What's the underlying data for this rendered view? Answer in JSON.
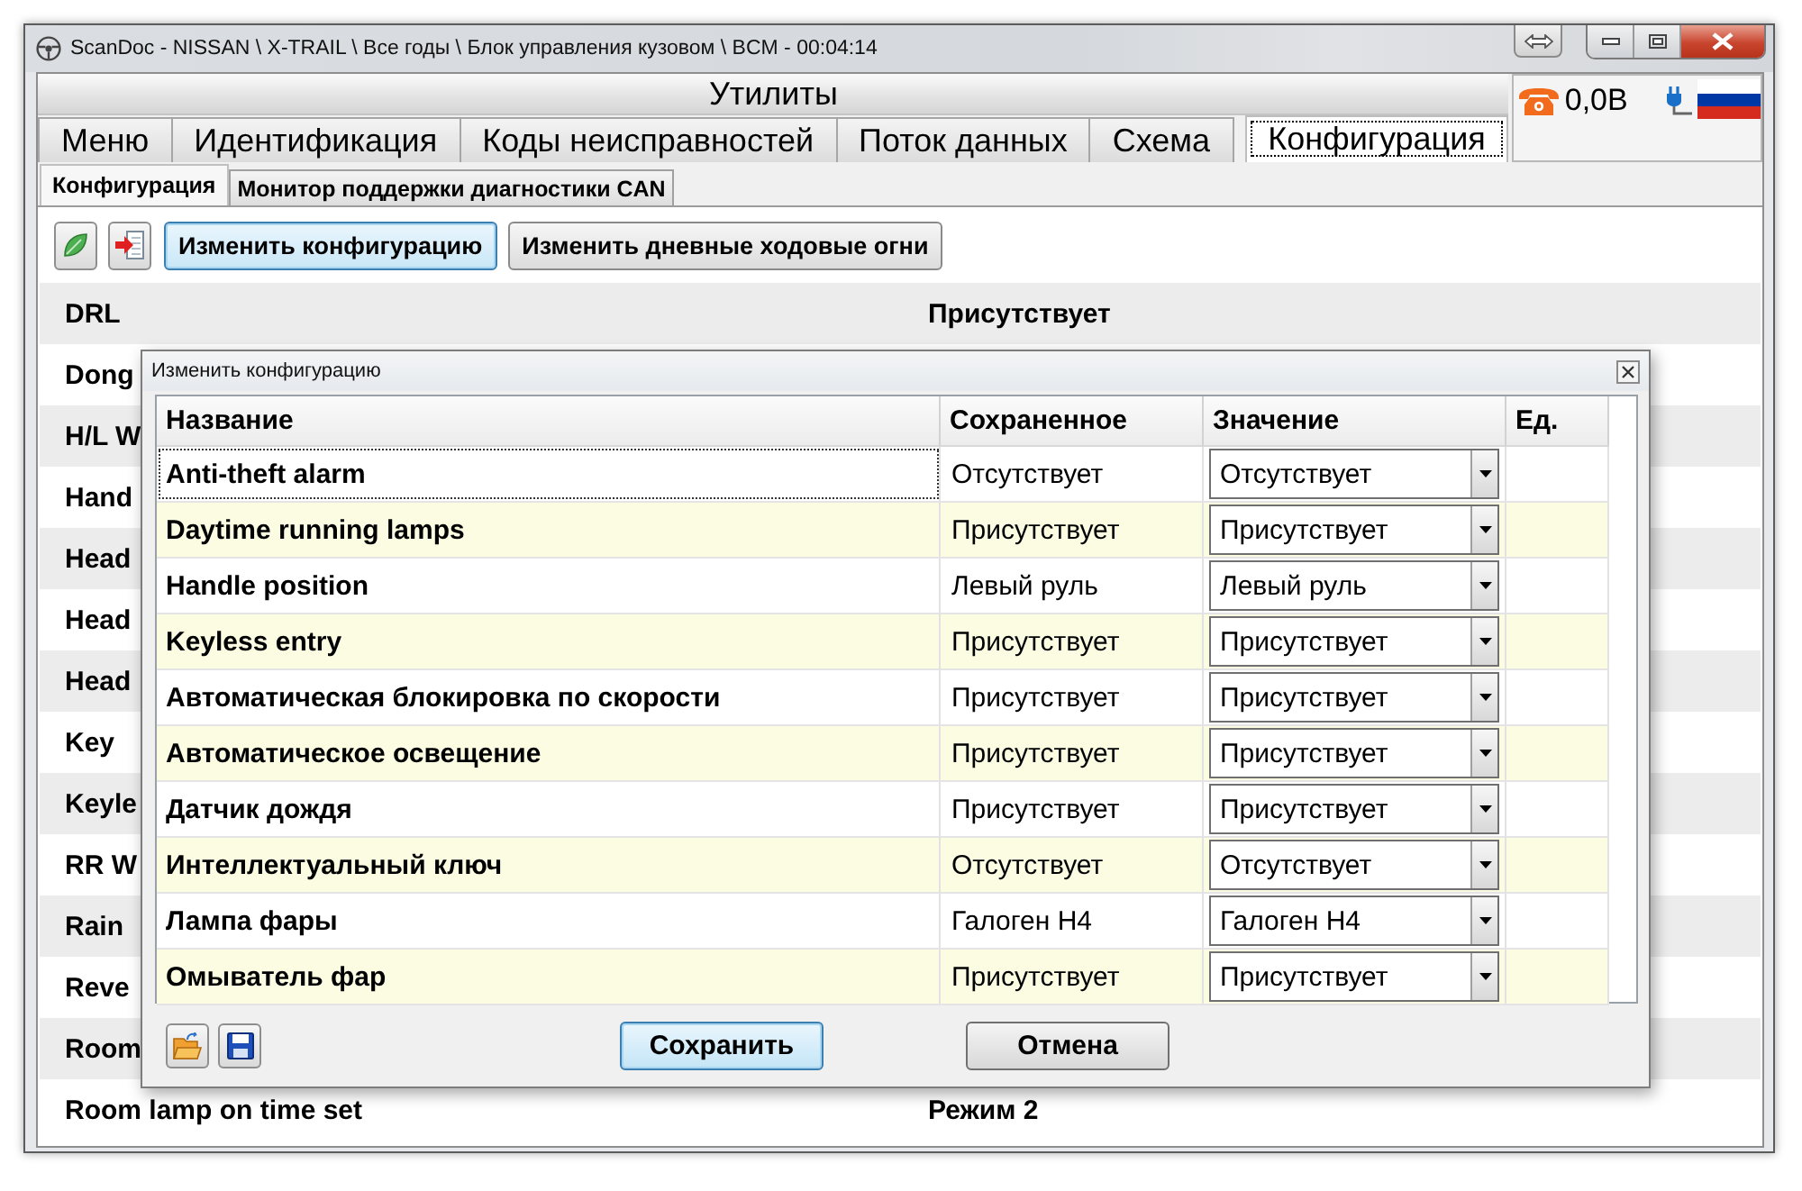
{
  "window": {
    "title": "ScanDoc - NISSAN \\ X-TRAIL \\ Все годы \\ Блок управления кузовом \\ BCM - 00:04:14"
  },
  "header": {
    "title": "Утилиты"
  },
  "status": {
    "voltage": "0,0В"
  },
  "tabs": [
    {
      "label": "Меню",
      "selected": false
    },
    {
      "label": "Идентификация",
      "selected": false
    },
    {
      "label": "Коды неисправностей",
      "selected": false
    },
    {
      "label": "Поток данных",
      "selected": false
    },
    {
      "label": "Схема",
      "selected": false
    },
    {
      "label": "Конфигурация",
      "selected": true
    }
  ],
  "subtabs": [
    {
      "label": "Конфигурация",
      "selected": true
    },
    {
      "label": "Монитор поддержки диагностики CAN",
      "selected": false
    }
  ],
  "toolbar": {
    "buttons": [
      {
        "label": "Изменить конфигурацию",
        "focused": true
      },
      {
        "label": "Изменить дневные ходовые огни",
        "focused": false
      }
    ]
  },
  "parameters": [
    {
      "name": "DRL",
      "value": "Присутствует"
    },
    {
      "name": "Dong"
    },
    {
      "name": "H/L W"
    },
    {
      "name": "Hand"
    },
    {
      "name": "Head"
    },
    {
      "name": "Head"
    },
    {
      "name": "Head"
    },
    {
      "name": "Key"
    },
    {
      "name": "Keyle"
    },
    {
      "name": "RR W"
    },
    {
      "name": "Rain"
    },
    {
      "name": "Reve"
    },
    {
      "name": "Room"
    },
    {
      "name": "Room lamp on time set",
      "value": "Режим 2"
    }
  ],
  "dialog": {
    "title": "Изменить конфигурацию",
    "columns": [
      "Название",
      "Сохраненное",
      "Значение",
      "Ед."
    ],
    "rows": [
      {
        "name": "Anti-theft alarm",
        "saved": "Отсутствует",
        "value": "Отсутствует",
        "focused": true
      },
      {
        "name": "Daytime running lamps",
        "saved": "Присутствует",
        "value": "Присутствует",
        "focused": false
      },
      {
        "name": "Handle position",
        "saved": "Левый руль",
        "value": "Левый руль",
        "focused": false
      },
      {
        "name": "Keyless entry",
        "saved": "Присутствует",
        "value": "Присутствует",
        "focused": false
      },
      {
        "name": "Автоматическая блокировка по скорости",
        "saved": "Присутствует",
        "value": "Присутствует",
        "focused": false
      },
      {
        "name": "Автоматическое освещение",
        "saved": "Присутствует",
        "value": "Присутствует",
        "focused": false
      },
      {
        "name": "Датчик дождя",
        "saved": "Присутствует",
        "value": "Присутствует",
        "focused": false
      },
      {
        "name": "Интеллектуальный ключ",
        "saved": "Отсутствует",
        "value": "Отсутствует",
        "focused": false
      },
      {
        "name": "Лампа фары",
        "saved": "Галоген H4",
        "value": "Галоген H4",
        "focused": false
      },
      {
        "name": "Омыватель фар",
        "saved": "Присутствует",
        "value": "Присутствует",
        "focused": false
      }
    ],
    "buttons": [
      {
        "label": "Сохранить",
        "focused": true
      },
      {
        "label": "Отмена",
        "focused": false
      }
    ]
  }
}
